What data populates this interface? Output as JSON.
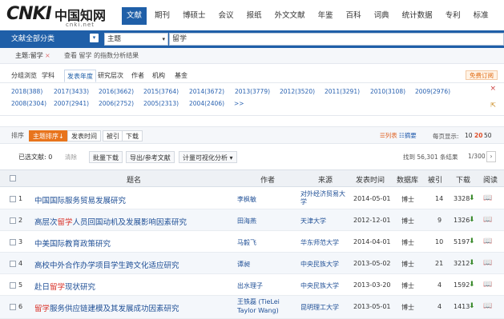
{
  "header": {
    "logo": {
      "mark": "CNKI",
      "cn": "中国知网",
      "url_text": "cnki.net"
    },
    "nav": [
      "文献",
      "期刊",
      "博硕士",
      "会议",
      "报纸",
      "外文文献",
      "年鉴",
      "百科",
      "词典",
      "统计数据",
      "专利",
      "标准"
    ],
    "active_nav": "文献"
  },
  "search": {
    "scope": "文献全部分类",
    "scope_btn": "▾",
    "field": "主题",
    "field_caret": "▾",
    "query": "留学"
  },
  "crumbs": {
    "filter": "主题:留学",
    "remove": "×",
    "analysis": "查看 留学 的指数分析结果"
  },
  "groups": {
    "items": [
      "分组浏览",
      "学科",
      "发表年度",
      "研究层次",
      "作者",
      "机构",
      "基金"
    ],
    "active": "发表年度",
    "free": "免费订阅"
  },
  "years": {
    "row1": [
      "2018(388)",
      "2017(3433)",
      "2016(3662)",
      "2015(3764)",
      "2014(3672)",
      "2013(3779)",
      "2012(3520)",
      "2011(3291)",
      "2010(3108)",
      "2009(2976)"
    ],
    "row2": [
      "2008(2304)",
      "2007(2941)",
      "2006(2752)",
      "2005(2313)",
      "2004(2406)",
      ">>"
    ],
    "close": "×",
    "more": "⇱"
  },
  "sortbar": {
    "label": "排序",
    "options": [
      "主题排序↓",
      "发表时间",
      "被引",
      "下载"
    ],
    "active": "主题排序↓",
    "mode_list": "☰列表",
    "mode_abstract": "☷摘要",
    "per_page_label": "每页显示:",
    "per_page": [
      "10",
      "20",
      "50"
    ],
    "per_page_current": "20"
  },
  "toolbar": {
    "selected": "已选文献: 0",
    "clear": "清除",
    "buttons": [
      "批量下载",
      "导出/参考文献",
      "计量可视化分析 ▾"
    ],
    "found": "找到 56,301 条结果",
    "page": "1/300",
    "next": "›"
  },
  "table": {
    "headers": [
      "题名",
      "作者",
      "来源",
      "发表时间",
      "数据库",
      "被引",
      "下载",
      "阅读"
    ],
    "rows": [
      {
        "n": "1",
        "title_pre": "中国国际服务贸易发展研究",
        "hl": "",
        "title_post": "",
        "author": "李枫敏",
        "source": "对外经济贸易大学",
        "date": "2014-05-01",
        "db": "博士",
        "cite": "14",
        "down": "3328"
      },
      {
        "n": "2",
        "title_pre": "高层次",
        "hl": "留学",
        "title_post": "人员回国动机及发展影响因素研究",
        "author": "田海燕",
        "source": "天津大学",
        "date": "2012-12-01",
        "db": "博士",
        "cite": "9",
        "down": "1326"
      },
      {
        "n": "3",
        "title_pre": "中美国际教育政策研究",
        "hl": "",
        "title_post": "",
        "author": "马毅飞",
        "source": "华东师范大学",
        "date": "2014-04-01",
        "db": "博士",
        "cite": "10",
        "down": "5197"
      },
      {
        "n": "4",
        "title_pre": "高校中外合作办学项目学生跨文化适应研究",
        "hl": "",
        "title_post": "",
        "author": "谭昶",
        "source": "中央民族大学",
        "date": "2013-05-02",
        "db": "博士",
        "cite": "21",
        "down": "3212"
      },
      {
        "n": "5",
        "title_pre": "赴日",
        "hl": "留学",
        "title_post": "现状研究",
        "author": "出水理子",
        "source": "中央民族大学",
        "date": "2013-03-20",
        "db": "博士",
        "cite": "4",
        "down": "1592"
      },
      {
        "n": "6",
        "title_pre": "",
        "hl": "留学",
        "title_post": "服务供应链建模及其发展成功因素研究",
        "author": "王铁磊 (TieLei Taylor Wang)",
        "source": "昆明理工大学",
        "date": "2013-05-01",
        "db": "博士",
        "cite": "4",
        "down": "1413"
      }
    ],
    "down_icon": "⬇",
    "read_icon": "📖"
  }
}
